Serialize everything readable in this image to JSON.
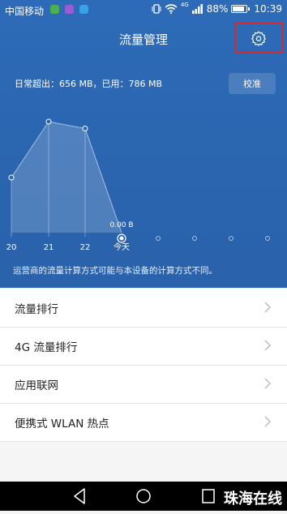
{
  "status": {
    "carrier": "中国移动",
    "network": "4G",
    "battery_pct": "88%",
    "battery_level": 0.88,
    "time": "10:39"
  },
  "header": {
    "title": "流量管理",
    "settings_icon": "gear-icon"
  },
  "summary": {
    "text": "日常超出：656 MB，已用：786 MB",
    "calibrate_label": "校准"
  },
  "chart_data": {
    "type": "area",
    "categories": [
      "20",
      "21",
      "22",
      "今天",
      "",
      "",
      "",
      "",
      ""
    ],
    "values": [
      72,
      145,
      136,
      0,
      null,
      null,
      null,
      null,
      null
    ],
    "current_value_label": "0.00 B",
    "grid": false
  },
  "note": "运营商的流量计算方式可能与本设备的计算方式不同。",
  "list": [
    {
      "label": "流量排行"
    },
    {
      "label": "4G 流量排行"
    },
    {
      "label": "应用联网"
    },
    {
      "label": "便携式 WLAN 热点"
    }
  ],
  "watermark": "珠海在线",
  "colors": {
    "primary": "#2b66b1",
    "highlight": "#d9272e"
  }
}
